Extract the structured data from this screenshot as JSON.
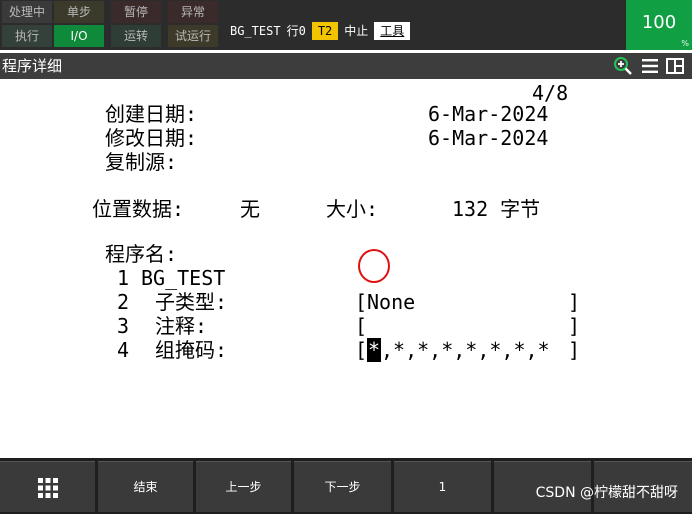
{
  "status_lamps": {
    "processing": "处理中",
    "step": "单步",
    "hold": "暂停",
    "fault": "异常",
    "run": "执行",
    "io": "I/O",
    "motion": "运转",
    "dry_run": "试运行"
  },
  "status_line": {
    "program": "BG_TEST",
    "line": "行0",
    "mode": "T2",
    "state": "中止",
    "frame": "工具"
  },
  "override": {
    "value": "100",
    "unit": "%"
  },
  "title_bar": {
    "title": "程序详细",
    "icons": [
      "zoom-in-icon",
      "menu-icon",
      "split-view-icon"
    ]
  },
  "detail": {
    "page": "4/8",
    "created_label": "创建日期:",
    "created_value": "6-Mar-2024",
    "modified_label": "修改日期:",
    "modified_value": "6-Mar-2024",
    "copy_source_label": "复制源:",
    "position_label": "位置数据:",
    "position_value": "无",
    "size_label": "大小:",
    "size_value": "132 字节",
    "program_name_label": "程序名:",
    "rows": [
      {
        "num": "1",
        "value": "BG_TEST"
      },
      {
        "num": "2",
        "label": "子类型:",
        "open": "[",
        "value": "None",
        "close": "]"
      },
      {
        "num": "3",
        "label": "注释:",
        "open": "[",
        "value": "",
        "close": "]"
      },
      {
        "num": "4",
        "label": "组掩码:",
        "open": "[",
        "selected": "*",
        "value": ",*,*,*,*,*,*,*",
        "close": "]"
      }
    ]
  },
  "softkeys": {
    "grid_icon": "grid-icon",
    "end": "结束",
    "prev": "上一步",
    "next": "下一步",
    "page": "1"
  },
  "watermark": "CSDN @柠檬甜不甜呀",
  "colors": {
    "io_lamp": "#0f8a3a",
    "override": "#10a043",
    "mode_badge": "#f2c400",
    "highlight_circle": "#e01010"
  }
}
